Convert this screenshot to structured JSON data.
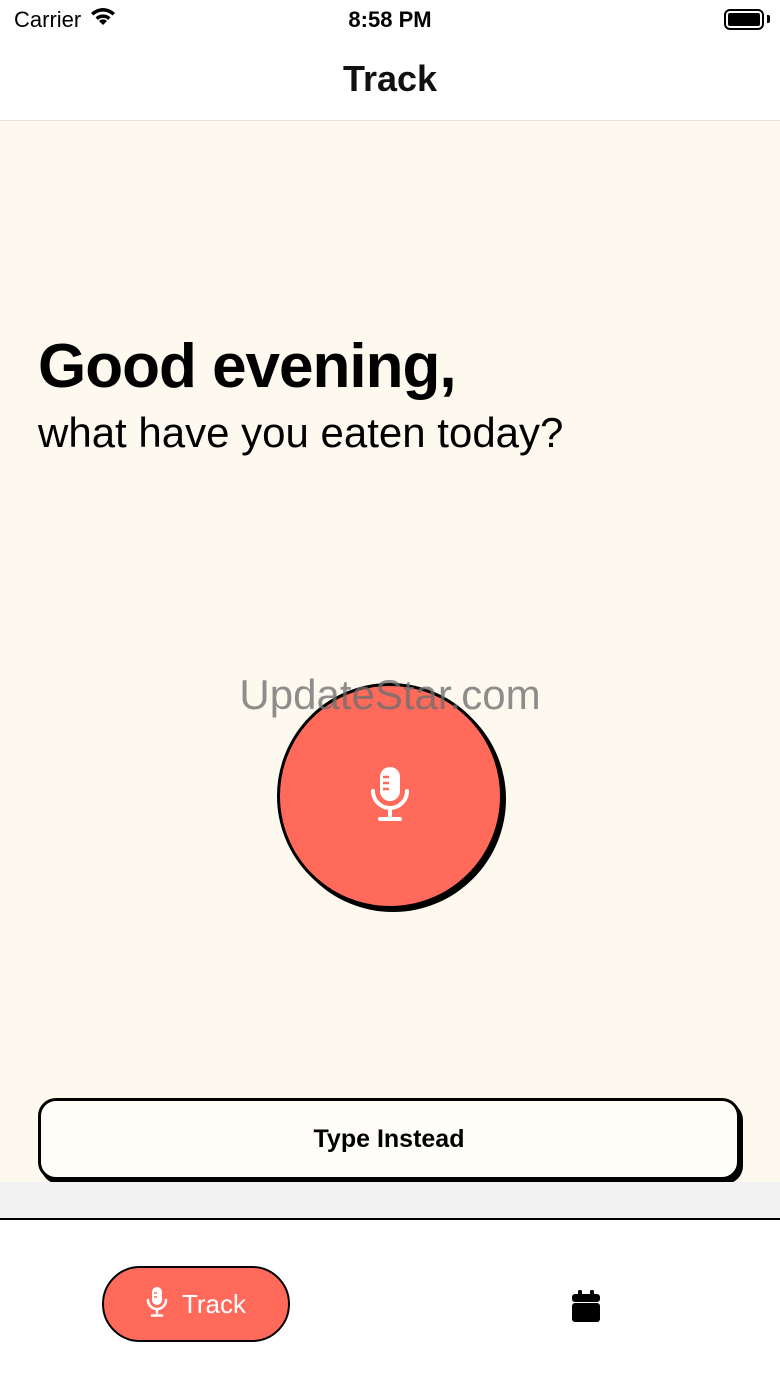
{
  "status_bar": {
    "carrier": "Carrier",
    "time": "8:58 PM",
    "wifi_icon": "wifi-icon",
    "battery_icon": "battery-icon"
  },
  "nav": {
    "title": "Track"
  },
  "main": {
    "greeting_title": "Good evening,",
    "greeting_subtitle": "what have you eaten today?",
    "watermark": "UpdateStar.com",
    "mic_icon": "microphone-icon",
    "type_instead_label": "Type Instead"
  },
  "tab_bar": {
    "track_label": "Track",
    "track_icon": "microphone-icon",
    "calendar_icon": "calendar-icon"
  },
  "colors": {
    "accent": "#ff6a5b",
    "background": "#fdf9ef",
    "border": "#000000"
  }
}
